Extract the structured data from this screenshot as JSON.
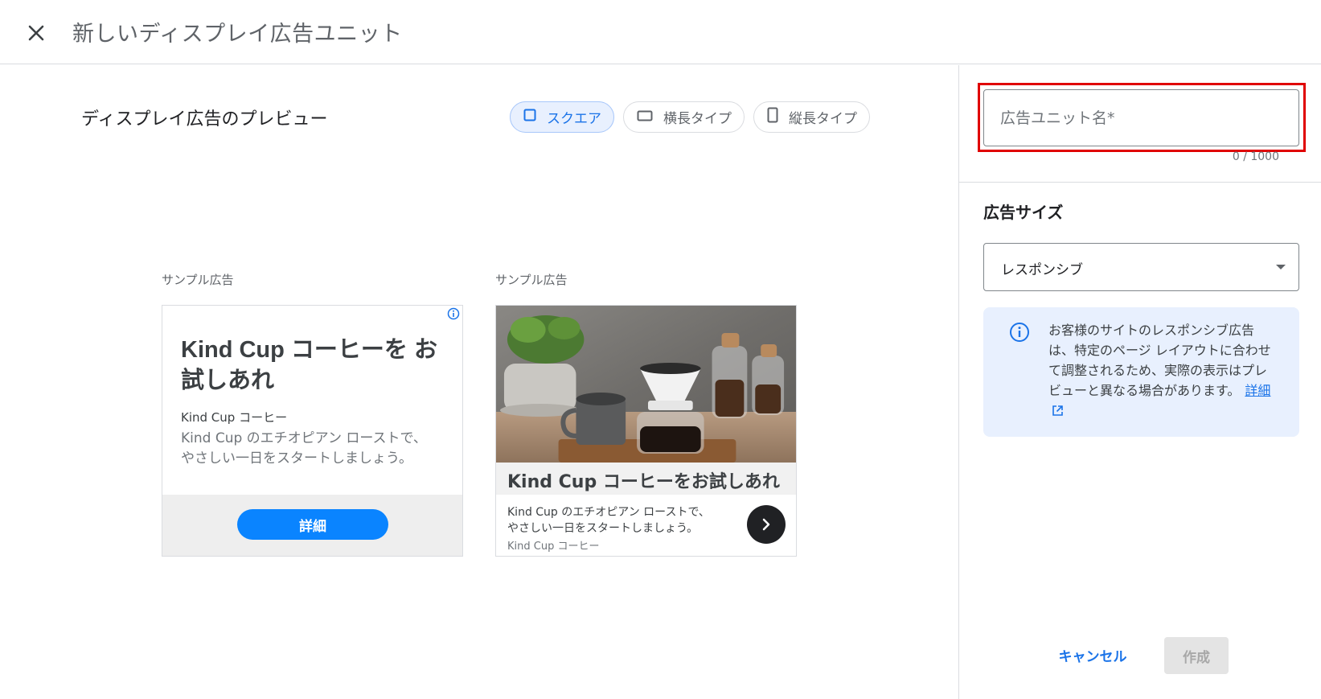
{
  "header": {
    "title": "新しいディスプレイ広告ユニット"
  },
  "preview": {
    "title": "ディスプレイ広告のプレビュー",
    "chips": [
      {
        "label": "スクエア",
        "selected": true,
        "icon": "square-icon"
      },
      {
        "label": "横長タイプ",
        "selected": false,
        "icon": "landscape-icon"
      },
      {
        "label": "縦長タイプ",
        "selected": false,
        "icon": "portrait-icon"
      }
    ]
  },
  "ad1": {
    "sample_label": "サンプル広告",
    "headline": "Kind Cup コーヒーを お試しあれ",
    "advertiser": "Kind Cup コーヒー",
    "description": "Kind Cup のエチオピアン ローストで、やさしい一日をスタートしましょう。",
    "cta": "詳細"
  },
  "ad2": {
    "sample_label": "サンプル広告",
    "headline": "Kind Cup コーヒーをお試しあれ",
    "description": "Kind Cup のエチオピアン ローストで、やさしい一日をスタートしましょう。",
    "advertiser": "Kind Cup コーヒー"
  },
  "side": {
    "name_placeholder": "広告ユニット名*",
    "name_value": "",
    "char_count": "0 / 1000",
    "size_heading": "広告サイズ",
    "size_value": "レスポンシブ",
    "info_text": "お客様のサイトのレスポンシブ広告は、特定のページ レイアウトに合わせて調整されるため、実際の表示はプレビューと異なる場合があります。",
    "info_link": "詳細",
    "cancel_label": "キャンセル",
    "create_label": "作成"
  },
  "colors": {
    "accent": "#1a73e8",
    "highlight": "#e00000",
    "cta_blue": "#0a84ff"
  }
}
